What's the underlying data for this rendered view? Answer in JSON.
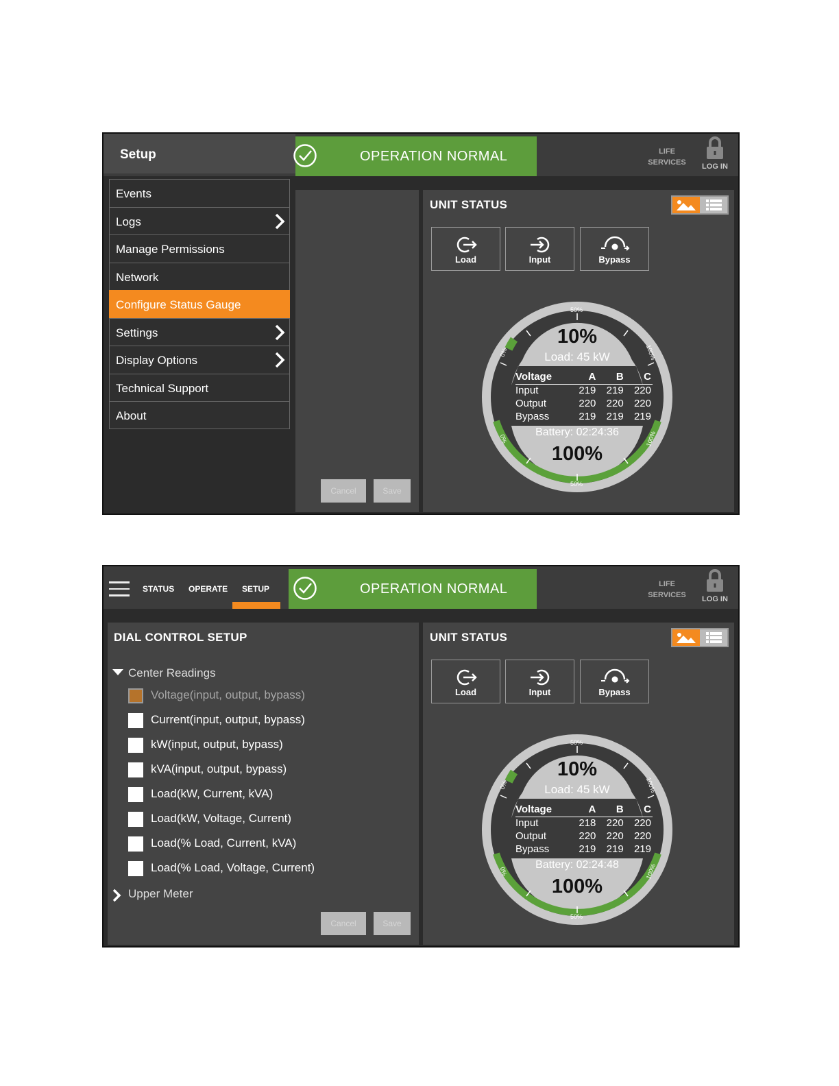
{
  "header": {
    "status_text": "OPERATION NORMAL",
    "life_line1": "LIFE",
    "life_line2": "SERVICES",
    "login_label": "LOG IN"
  },
  "shot1": {
    "sidebar_title": "Setup",
    "menu": [
      {
        "label": "Events",
        "has_arrow": false
      },
      {
        "label": "Logs",
        "has_arrow": true
      },
      {
        "label": "Manage Permissions",
        "has_arrow": false
      },
      {
        "label": "Network",
        "has_arrow": false
      },
      {
        "label": "Configure Status Gauge",
        "has_arrow": false,
        "active": true
      },
      {
        "label": "Settings",
        "has_arrow": true
      },
      {
        "label": "Display Options",
        "has_arrow": true
      },
      {
        "label": "Technical Support",
        "has_arrow": false
      },
      {
        "label": "About",
        "has_arrow": false
      }
    ],
    "gauge": {
      "load_pct": "10%",
      "load_kw": "Load: 45 kW",
      "battery_time": "Battery: 02:24:36",
      "battery_pct": "100%",
      "rows": [
        {
          "name": "Input",
          "a": "219",
          "b": "219",
          "c": "220"
        },
        {
          "name": "Output",
          "a": "220",
          "b": "220",
          "c": "220"
        },
        {
          "name": "Bypass",
          "a": "219",
          "b": "219",
          "c": "219"
        }
      ]
    }
  },
  "shot2": {
    "nav_tabs": [
      "STATUS",
      "OPERATE",
      "SETUP"
    ],
    "active_tab": "SETUP",
    "dial_title": "DIAL CONTROL SETUP",
    "center_readings_label": "Center Readings",
    "upper_meter_label": "Upper Meter",
    "options": [
      {
        "label": "Voltage(input, output, bypass)",
        "checked": true
      },
      {
        "label": "Current(input, output, bypass)",
        "checked": false
      },
      {
        "label": "kW(input, output, bypass)",
        "checked": false
      },
      {
        "label": "kVA(input, output, bypass)",
        "checked": false
      },
      {
        "label": "Load(kW, Current, kVA)",
        "checked": false
      },
      {
        "label": "Load(kW, Voltage, Current)",
        "checked": false
      },
      {
        "label": "Load(% Load, Current, kVA)",
        "checked": false
      },
      {
        "label": "Load(% Load, Voltage, Current)",
        "checked": false
      }
    ],
    "gauge": {
      "load_pct": "10%",
      "load_kw": "Load: 45 kW",
      "battery_time": "Battery: 02:24:48",
      "battery_pct": "100%",
      "rows": [
        {
          "name": "Input",
          "a": "218",
          "b": "220",
          "c": "220"
        },
        {
          "name": "Output",
          "a": "220",
          "b": "220",
          "c": "220"
        },
        {
          "name": "Bypass",
          "a": "219",
          "b": "219",
          "c": "219"
        }
      ]
    }
  },
  "unit_status": {
    "title": "UNIT STATUS",
    "buttons": [
      "Load",
      "Input",
      "Bypass"
    ],
    "table_header": {
      "label": "Voltage",
      "a": "A",
      "b": "B",
      "c": "C"
    },
    "tick_labels": {
      "top": "50%",
      "bottom": "50%",
      "left_upper": "0%",
      "left_lower": "0%",
      "right_upper": "100%",
      "right_lower": "100%"
    }
  },
  "actions": {
    "cancel": "Cancel",
    "save": "Save"
  },
  "colors": {
    "accent": "#f48a1f",
    "status_green": "#5d9d3c",
    "panel": "#444444",
    "background": "#2b2b2b"
  },
  "icons": [
    "check-circle-icon",
    "lock-icon",
    "chevron-right-icon",
    "chevron-down-icon",
    "hamburger-icon",
    "load-icon",
    "input-icon",
    "bypass-icon",
    "image-view-icon",
    "list-view-icon"
  ]
}
